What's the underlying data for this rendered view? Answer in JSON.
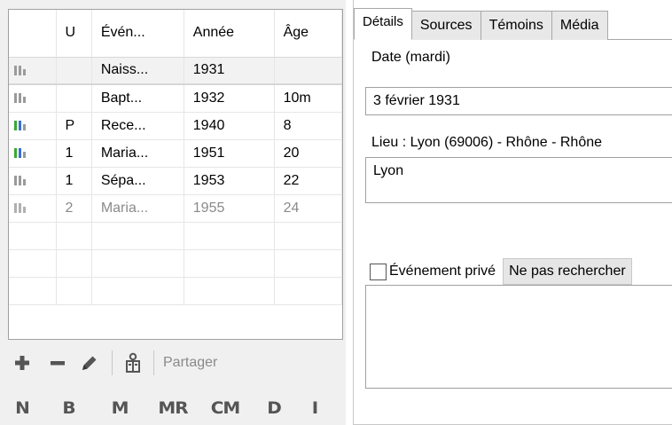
{
  "events_table": {
    "columns": [
      "",
      "U",
      "Évén...",
      "Année",
      "Âge"
    ],
    "rows": [
      {
        "u": "",
        "event": "Naiss...",
        "year": "1931",
        "age": "",
        "bars": [
          "#9a9a9a",
          "#9a9a9a",
          "#9a9a9a"
        ],
        "selected": true,
        "dim": false
      },
      {
        "u": "",
        "event": "Bapt...",
        "year": "1932",
        "age": "10m",
        "bars": [
          "#9a9a9a",
          "#9a9a9a",
          "#9a9a9a"
        ],
        "selected": false,
        "dim": false
      },
      {
        "u": "P",
        "event": "Rece...",
        "year": "1940",
        "age": "8",
        "bars": [
          "#3aa830",
          "#3a6fd8",
          "#9a9a9a"
        ],
        "selected": false,
        "dim": false
      },
      {
        "u": "1",
        "event": "Maria...",
        "year": "1951",
        "age": "20",
        "bars": [
          "#3aa830",
          "#3a6fd8",
          "#9a9a9a"
        ],
        "selected": false,
        "dim": false
      },
      {
        "u": "1",
        "event": "Sépa...",
        "year": "1953",
        "age": "22",
        "bars": [
          "#9a9a9a",
          "#9a9a9a",
          "#9a9a9a"
        ],
        "selected": false,
        "dim": false
      },
      {
        "u": "2",
        "event": "Maria...",
        "year": "1955",
        "age": "24",
        "bars": [
          "#b0b0b0",
          "#b0b0b0",
          "#b0b0b0"
        ],
        "selected": false,
        "dim": true
      },
      {
        "u": "",
        "event": "",
        "year": "",
        "age": "",
        "bars": [],
        "selected": false,
        "dim": false
      },
      {
        "u": "",
        "event": "",
        "year": "",
        "age": "",
        "bars": [],
        "selected": false,
        "dim": false
      },
      {
        "u": "",
        "event": "",
        "year": "",
        "age": "",
        "bars": [],
        "selected": false,
        "dim": false
      }
    ]
  },
  "toolbar": {
    "add_icon": "plus-icon",
    "remove_icon": "minus-icon",
    "edit_icon": "pencil-icon",
    "witness_icon": "person-box-icon",
    "share_label": "Partager"
  },
  "shortcuts": [
    "N",
    "B",
    "M",
    "MR",
    "CM",
    "D",
    "I"
  ],
  "tabs": [
    "Détails",
    "Sources",
    "Témoins",
    "Média"
  ],
  "details": {
    "date_label": "Date (mardi)",
    "date_value": "3 février 1931",
    "place_label": "Lieu : Lyon (69006) - Rhône - Rhône",
    "place_value": "Lyon",
    "private_label": "Événement privé",
    "no_search_label": "Ne pas rechercher"
  },
  "colors": {
    "panel_bg": "#f0f0f0",
    "border": "#a0a0a0",
    "bar_grey": "#9a9a9a",
    "bar_green": "#3aa830",
    "bar_blue": "#3a6fd8"
  }
}
